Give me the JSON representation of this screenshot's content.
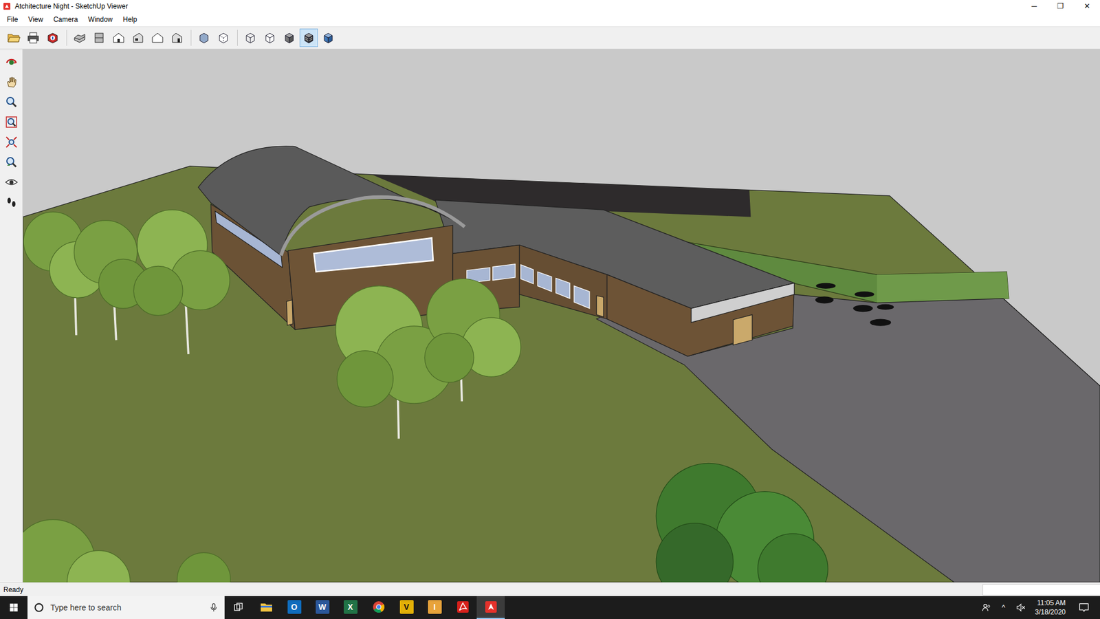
{
  "window": {
    "title": "Atchitecture Night - SketchUp Viewer",
    "controls": [
      "─",
      "❐",
      "✕"
    ]
  },
  "menu": [
    "File",
    "View",
    "Camera",
    "Window",
    "Help"
  ],
  "toolbar": {
    "groups": [
      [
        {
          "selected": false
        },
        {
          "selected": false
        },
        {
          "selected": false
        }
      ],
      [
        {
          "selected": false
        },
        {
          "selected": false
        },
        {
          "selected": false
        },
        {
          "selected": false
        },
        {
          "selected": false
        },
        {
          "selected": false
        }
      ],
      [
        {
          "selected": false
        },
        {
          "selected": false
        }
      ],
      [
        {
          "selected": false
        },
        {
          "selected": false
        },
        {
          "selected": false
        },
        {
          "selected": true
        },
        {
          "selected": false
        }
      ]
    ]
  },
  "tools": [
    {
      "selected": false
    },
    {
      "selected": false
    },
    {
      "selected": false
    },
    {
      "selected": false
    },
    {
      "selected": false
    },
    {
      "selected": false
    },
    {
      "selected": false
    },
    {
      "selected": false
    }
  ],
  "status_bar": {
    "text": "Ready"
  },
  "taskbar": {
    "search": {
      "placeholder": "Type here to search"
    },
    "apps": [
      {
        "kind": "explorer",
        "glyph": "",
        "color": "#f3c443",
        "selected": false
      },
      {
        "kind": "letter",
        "glyph": "O",
        "color": "#0f6cbd",
        "selected": false
      },
      {
        "kind": "letter",
        "glyph": "W",
        "color": "#2b579a",
        "selected": false
      },
      {
        "kind": "letter",
        "glyph": "X",
        "color": "#217346",
        "selected": false
      },
      {
        "kind": "chrome",
        "glyph": "",
        "color": "#4285f4",
        "selected": false
      },
      {
        "kind": "letter",
        "glyph": "V",
        "color": "#e2b007",
        "selected": false
      },
      {
        "kind": "letter",
        "glyph": "I",
        "color": "#e8a33b",
        "selected": false
      },
      {
        "kind": "acrobat",
        "glyph": "",
        "color": "#d6201b",
        "selected": false
      },
      {
        "kind": "sketchup",
        "glyph": "",
        "color": "#e4312b",
        "selected": true
      }
    ],
    "tray": {
      "caret": "^",
      "time": "11:05 AM",
      "date": "3/18/2020"
    }
  }
}
